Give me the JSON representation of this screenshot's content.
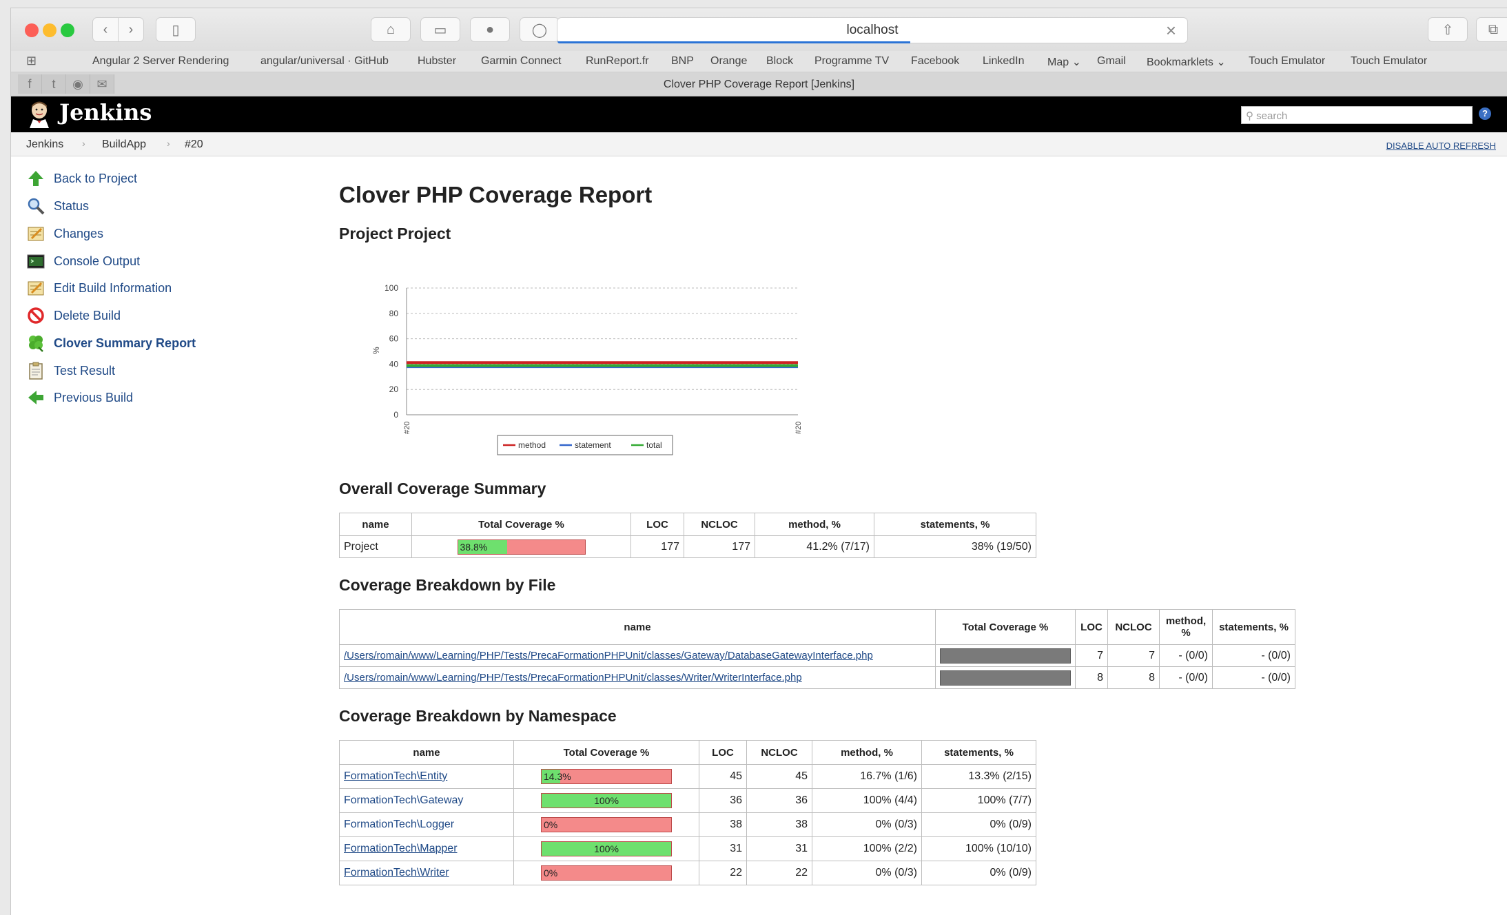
{
  "browser": {
    "address": "localhost",
    "tab_title": "Clover PHP Coverage Report [Jenkins]",
    "bookmarks": [
      "Angular 2 Server Rendering",
      "angular/universal · GitHub",
      "Hubster",
      "Garmin Connect",
      "RunReport.fr",
      "BNP",
      "Orange",
      "Block",
      "Programme TV",
      "Facebook",
      "LinkedIn",
      "Map",
      "Gmail",
      "Bookmarklets",
      "Touch Emulator",
      "Touch Emulator"
    ]
  },
  "jenkins": {
    "brand": "Jenkins",
    "search_placeholder": "search",
    "help": "?",
    "breadcrumbs": [
      "Jenkins",
      "BuildApp",
      "#20"
    ],
    "auto_refresh": "DISABLE AUTO REFRESH"
  },
  "sidebar": {
    "items": [
      {
        "label": "Back to Project",
        "icon": "up-arrow-icon"
      },
      {
        "label": "Status",
        "icon": "magnifier-icon"
      },
      {
        "label": "Changes",
        "icon": "notepad-icon"
      },
      {
        "label": "Console Output",
        "icon": "terminal-icon"
      },
      {
        "label": "Edit Build Information",
        "icon": "notepad-icon"
      },
      {
        "label": "Delete Build",
        "icon": "no-entry-icon"
      },
      {
        "label": "Clover Summary Report",
        "icon": "clover-icon"
      },
      {
        "label": "Test Result",
        "icon": "clipboard-icon"
      },
      {
        "label": "Previous Build",
        "icon": "left-arrow-icon"
      }
    ]
  },
  "report": {
    "title": "Clover PHP Coverage Report",
    "project_heading": "Project Project",
    "overall_heading": "Overall Coverage Summary",
    "by_file_heading": "Coverage Breakdown by File",
    "by_namespace_heading": "Coverage Breakdown by Namespace"
  },
  "chart_data": {
    "type": "line",
    "x": [
      "#20",
      "#20"
    ],
    "ylabel": "%",
    "ylim": [
      0,
      100
    ],
    "yticks": [
      0,
      20,
      40,
      60,
      80,
      100
    ],
    "grid": true,
    "legend_position": "bottom",
    "series": [
      {
        "name": "method",
        "values": [
          41.2,
          41.2
        ],
        "color": "#cc2222"
      },
      {
        "name": "statement",
        "values": [
          38,
          38
        ],
        "color": "#3366cc"
      },
      {
        "name": "total",
        "values": [
          38.8,
          38.8
        ],
        "color": "#33aa33"
      }
    ]
  },
  "overall": {
    "columns": [
      "name",
      "Total Coverage %",
      "LOC",
      "NCLOC",
      "method, %",
      "statements, %"
    ],
    "rows": [
      {
        "name": "Project",
        "coverage": 38.8,
        "coverage_label": "38.8%",
        "loc": "177",
        "ncloc": "177",
        "method": "41.2% (7/17)",
        "statements": "38% (19/50)"
      }
    ]
  },
  "by_file": {
    "columns": [
      "name",
      "Total Coverage %",
      "LOC",
      "NCLOC",
      "method, %",
      "statements, %"
    ],
    "rows": [
      {
        "name": "/Users/romain/www/Learning/PHP/Tests/PrecaFormationPHPUnit/classes/Gateway/DatabaseGatewayInterface.php",
        "loc": "7",
        "ncloc": "7",
        "method": "- (0/0)",
        "statements": "- (0/0)"
      },
      {
        "name": "/Users/romain/www/Learning/PHP/Tests/PrecaFormationPHPUnit/classes/Writer/WriterInterface.php",
        "loc": "8",
        "ncloc": "8",
        "method": "- (0/0)",
        "statements": "- (0/0)"
      }
    ]
  },
  "by_namespace": {
    "columns": [
      "name",
      "Total Coverage %",
      "LOC",
      "NCLOC",
      "method, %",
      "statements, %"
    ],
    "rows": [
      {
        "name": "FormationTech\\Entity",
        "coverage": 14.3,
        "coverage_label": "14.3%",
        "loc": "45",
        "ncloc": "45",
        "method": "16.7% (1/6)",
        "statements": "13.3% (2/15)",
        "link": true
      },
      {
        "name": "FormationTech\\Gateway",
        "coverage": 100,
        "coverage_label": "100%",
        "loc": "36",
        "ncloc": "36",
        "method": "100% (4/4)",
        "statements": "100% (7/7)",
        "link": false
      },
      {
        "name": "FormationTech\\Logger",
        "coverage": 0,
        "coverage_label": "0%",
        "loc": "38",
        "ncloc": "38",
        "method": "0% (0/3)",
        "statements": "0% (0/9)",
        "link": false
      },
      {
        "name": "FormationTech\\Mapper",
        "coverage": 100,
        "coverage_label": "100%",
        "loc": "31",
        "ncloc": "31",
        "method": "100% (2/2)",
        "statements": "100% (10/10)",
        "link": true
      },
      {
        "name": "FormationTech\\Writer",
        "coverage": 0,
        "coverage_label": "0%",
        "loc": "22",
        "ncloc": "22",
        "method": "0% (0/3)",
        "statements": "0% (0/9)",
        "link": true
      }
    ]
  }
}
